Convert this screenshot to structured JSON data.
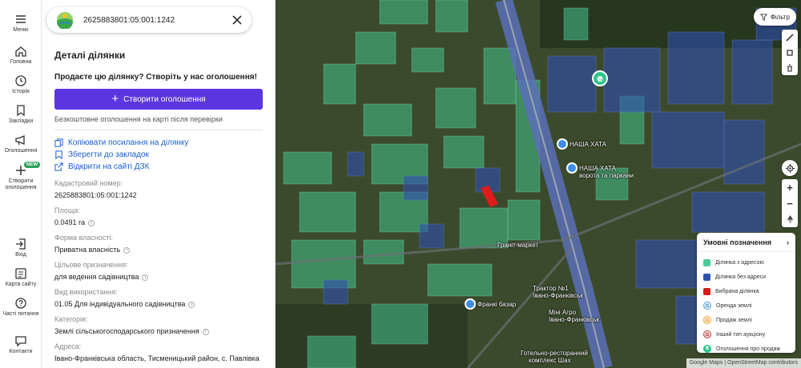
{
  "rail": {
    "menu_label": "Меню",
    "items": [
      {
        "label": "Головна"
      },
      {
        "label": "Історія"
      },
      {
        "label": "Закладки"
      },
      {
        "label": "Оголошення"
      },
      {
        "label": "Створити оголошення",
        "badge": "NEW"
      },
      {
        "label": "Вхід"
      },
      {
        "label": "Карта сайту"
      },
      {
        "label": "Часті питання"
      },
      {
        "label": "Контакти"
      }
    ]
  },
  "search": {
    "value": "2625883801:05:001:1242",
    "placeholder": ""
  },
  "panel": {
    "title": "Деталі ділянки",
    "sell_prompt": "Продаєте цю ділянку? Створіть у нас оголошення!",
    "create_button": "Створити оголошення",
    "create_note": "Безкоштовне оголошення на карті після перевірки",
    "links": {
      "copy": "Копіювати посилання на ділянку",
      "bookmark": "Зберегти до закладок",
      "dzk": "Відкрити на сайті ДЗК"
    },
    "fields": [
      {
        "label": "Кадастровий номер:",
        "value": "2625883801:05:001:1242"
      },
      {
        "label": "Площа:",
        "value": "0.0491 га"
      },
      {
        "label": "Форма власності:",
        "value": "Приватна власність"
      },
      {
        "label": "Цільове призначення:",
        "value": "для ведення садівництва"
      },
      {
        "label": "Вид використання:",
        "value": "01.05 Для індивідуального садівництва"
      },
      {
        "label": "Категорія:",
        "value": "Землі сільськогосподарського призначення"
      },
      {
        "label": "Адреса:",
        "value": "Івано-Франківська область, Тисменицький район, с. Павлівка"
      }
    ]
  },
  "map": {
    "filter_label": "Фільтр",
    "zoom_in": "+",
    "zoom_out": "−",
    "labels": {
      "hata": "НАША ХАТА",
      "vorota": "ворота та паркани",
      "granit": "Граніт-маркет",
      "traktor": "Трактор №1",
      "traktor_city": "Івано-Франківськ",
      "frank": "Франкі базар",
      "mini": "Міні Агро",
      "mini_city": "Івано-Франківськ",
      "hotel": "Готельно-ресторанний",
      "hotel2": "комплекс Шах"
    },
    "attribution": "Google Maps | OpenStreetMap contributors"
  },
  "legend": {
    "title": "Умовні позначення",
    "items": [
      {
        "label": "Ділянка з адресою",
        "color": "#4fc89a"
      },
      {
        "label": "Ділянка без адреси",
        "color": "#2f4fb0"
      },
      {
        "label": "Вибрана ділянка",
        "color": "#d81b1b"
      },
      {
        "label": "Оренда землі",
        "color": "#4fa3d8"
      },
      {
        "label": "Продаж землі",
        "color": "#f0a030"
      },
      {
        "label": "Інший тип аукціону",
        "color": "#c04040"
      },
      {
        "label": "Оголошення про продаж",
        "color": "#2ec48a"
      }
    ]
  },
  "colors": {
    "accent": "#5b36e0",
    "link": "#1a5fd0"
  }
}
